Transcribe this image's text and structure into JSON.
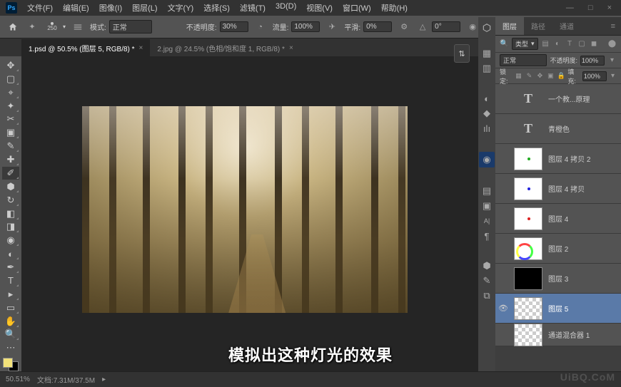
{
  "app": {
    "logo": "Ps"
  },
  "menu": [
    "文件(F)",
    "编辑(E)",
    "图像(I)",
    "图层(L)",
    "文字(Y)",
    "选择(S)",
    "滤镜(T)",
    "3D(D)",
    "视图(V)",
    "窗口(W)",
    "帮助(H)"
  ],
  "win_controls": {
    "min": "—",
    "max": "□",
    "close": "×"
  },
  "optionbar": {
    "brush_size": "250",
    "mode_label": "模式:",
    "mode_value": "正常",
    "opacity_label": "不透明度:",
    "opacity_value": "30%",
    "flow_label": "流量:",
    "flow_value": "100%",
    "smooth_label": "平滑:",
    "smooth_value": "0%",
    "angle_value": "0°"
  },
  "tabs": [
    {
      "title": "1.psd @ 50.5% (图层 5, RGB/8) *",
      "active": true
    },
    {
      "title": "2.jpg @ 24.5% (色相/饱和度 1, RGB/8) *",
      "active": false
    }
  ],
  "subtitle": "模拟出这种灯光的效果",
  "panel_tabs": {
    "layers": "图层",
    "paths": "路径",
    "channels": "通道"
  },
  "layer_filter": {
    "kind_label": "类型"
  },
  "layer_blend": {
    "mode": "正常",
    "opacity_label": "不透明度:",
    "opacity": "100%"
  },
  "layer_lock": {
    "label": "锁定:",
    "fill_label": "填充:",
    "fill": "100%"
  },
  "layers": [
    {
      "type": "text",
      "name": "一个教...原理",
      "dot": ""
    },
    {
      "type": "text",
      "name": "青橙色",
      "dot": ""
    },
    {
      "type": "thumb",
      "name": "图层 4 拷贝 2",
      "dot": "#2a2"
    },
    {
      "type": "thumb",
      "name": "图层 4 拷贝",
      "dot": "#22d"
    },
    {
      "type": "thumb",
      "name": "图层 4",
      "dot": "#d22"
    },
    {
      "type": "rings",
      "name": "图层 2",
      "dot": ""
    },
    {
      "type": "black",
      "name": "图层 3",
      "dot": ""
    },
    {
      "type": "checker",
      "name": "图层 5",
      "dot": "",
      "selected": true,
      "visible": true
    },
    {
      "type": "checker",
      "name": "通道混合器 1",
      "dot": "",
      "small": true
    }
  ],
  "status": {
    "zoom": "50.51%",
    "doc": "文档:7.31M/37.5M"
  },
  "watermark": "UiBQ.CoM"
}
